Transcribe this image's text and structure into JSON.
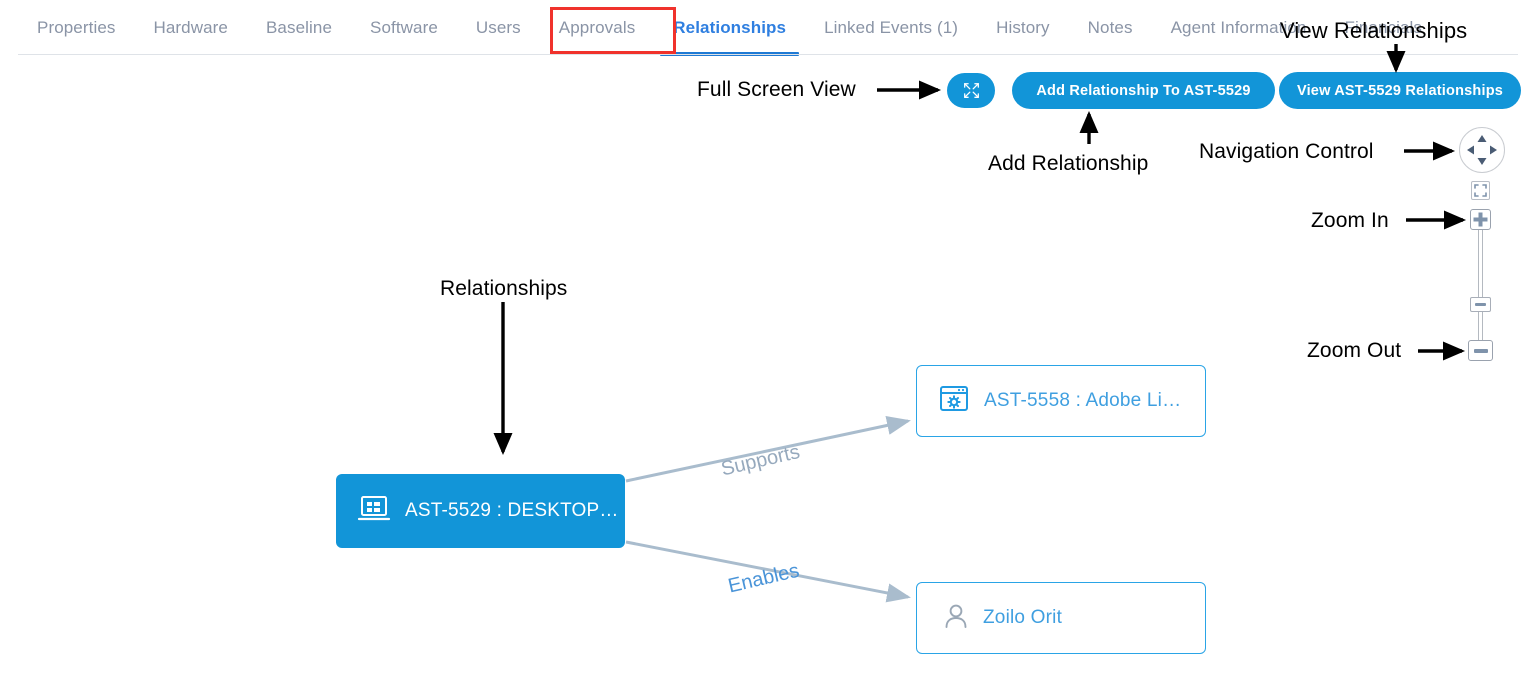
{
  "tabs": [
    {
      "label": "Properties",
      "active": false
    },
    {
      "label": "Hardware",
      "active": false
    },
    {
      "label": "Baseline",
      "active": false
    },
    {
      "label": "Software",
      "active": false
    },
    {
      "label": "Users",
      "active": false
    },
    {
      "label": "Approvals",
      "active": false
    },
    {
      "label": "Relationships",
      "active": true
    },
    {
      "label": "Linked Events (1)",
      "active": false
    },
    {
      "label": "History",
      "active": false
    },
    {
      "label": "Notes",
      "active": false
    },
    {
      "label": "Agent Information",
      "active": false
    },
    {
      "label": "Financials",
      "active": false
    }
  ],
  "toolbar": {
    "fullscreen_icon": "expand-arrows-icon",
    "add_relationship_label": "Add Relationship To AST-5529",
    "view_relationships_label": "View AST-5529 Relationships"
  },
  "nav_control": {
    "dial_icon": "four-way-pan-icon",
    "fit_icon": "fit-to-screen-icon",
    "zoom_in_icon": "plus-icon",
    "zoom_out_icon": "minus-icon",
    "slider_handle_icon": "slider-handle-icon"
  },
  "graph": {
    "nodes": [
      {
        "id": "root",
        "label": "AST-5529 : DESKTOP…",
        "icon": "windows-laptop-icon",
        "selected": true
      },
      {
        "id": "software",
        "label": "AST-5558 : Adobe Li…",
        "icon": "software-window-gear-icon",
        "selected": false
      },
      {
        "id": "person",
        "label": "Zoilo Orit",
        "icon": "user-icon",
        "selected": false
      }
    ],
    "edges": [
      {
        "from": "root",
        "to": "software",
        "label": "Supports",
        "color": "#96a9bd"
      },
      {
        "from": "root",
        "to": "person",
        "label": "Enables",
        "color": "#4a94d8"
      }
    ]
  },
  "annotations": [
    {
      "id": "full-screen-view",
      "text": "Full Screen View"
    },
    {
      "id": "add-relationship",
      "text": "Add Relationship"
    },
    {
      "id": "view-relationships",
      "text": "View Relationships"
    },
    {
      "id": "navigation-control",
      "text": "Navigation Control"
    },
    {
      "id": "zoom-in",
      "text": "Zoom In"
    },
    {
      "id": "zoom-out",
      "text": "Zoom Out"
    },
    {
      "id": "relationships",
      "text": "Relationships"
    }
  ],
  "colors": {
    "accent_blue": "#1295d8",
    "tab_active": "#2f7fe0",
    "tab_inactive": "#8a94a6",
    "highlight_red": "#f0322c",
    "node_border": "#2aa4e6",
    "edge_gray": "#96a9bd"
  }
}
